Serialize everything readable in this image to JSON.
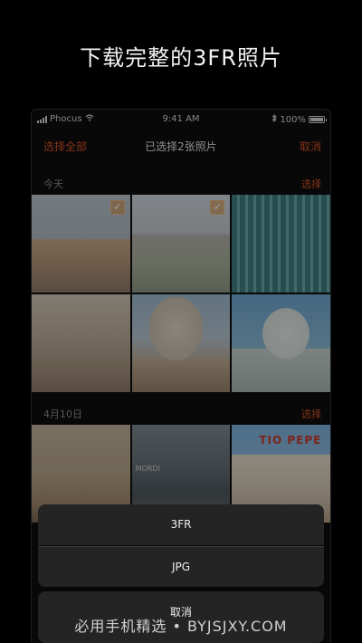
{
  "headline": "下载完整的3FR照片",
  "status_bar": {
    "carrier": "Phocus",
    "time": "9:41 AM",
    "battery": "100%"
  },
  "nav": {
    "select_all": "选择全部",
    "title": "已选择2张照片",
    "cancel": "取消"
  },
  "sections": [
    {
      "title": "今天",
      "action": "选择",
      "photos": [
        {
          "selected": true
        },
        {
          "selected": true
        },
        {
          "selected": false
        },
        {
          "selected": false
        },
        {
          "selected": false
        },
        {
          "selected": false
        }
      ]
    },
    {
      "title": "4月10日",
      "action": "选择",
      "photos": [
        {
          "selected": false
        },
        {
          "selected": false,
          "sign": "MORDI"
        },
        {
          "selected": false,
          "sign": "TIO PEPE"
        }
      ]
    }
  ],
  "action_sheet": {
    "option_1": "3FR",
    "option_2": "JPG",
    "cancel": "取消"
  },
  "watermark": "必用手机精选 • BYJSJXY.COM",
  "colors": {
    "accent": "#d9532a",
    "sheet_bg": "#242424"
  }
}
